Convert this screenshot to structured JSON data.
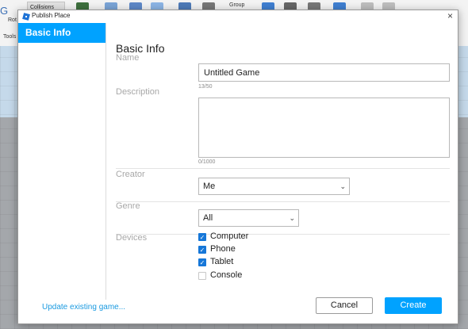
{
  "studio": {
    "toolbar_labels": {
      "collisions": "Collisions",
      "rotate": "Rot",
      "tools": "Tools",
      "group": "Group"
    }
  },
  "dialog": {
    "title": "Publish Place",
    "close_glyph": "×",
    "sidebar": {
      "items": [
        {
          "label": "Basic Info",
          "selected": true
        }
      ]
    },
    "heading": "Basic Info",
    "name": {
      "label": "Name",
      "value": "Untitled Game",
      "counter": "13/50"
    },
    "description": {
      "label": "Description",
      "value": "",
      "counter": "0/1000"
    },
    "creator": {
      "label": "Creator",
      "selected": "Me"
    },
    "genre": {
      "label": "Genre",
      "selected": "All"
    },
    "devices": {
      "label": "Devices",
      "options": [
        {
          "label": "Computer",
          "checked": true
        },
        {
          "label": "Phone",
          "checked": true
        },
        {
          "label": "Tablet",
          "checked": true
        },
        {
          "label": "Console",
          "checked": false
        }
      ]
    },
    "footer": {
      "update_link": "Update existing game...",
      "cancel": "Cancel",
      "create": "Create"
    },
    "colors": {
      "accent": "#00a2ff",
      "checkbox": "#1677d8",
      "link": "#1a9ae0"
    }
  }
}
